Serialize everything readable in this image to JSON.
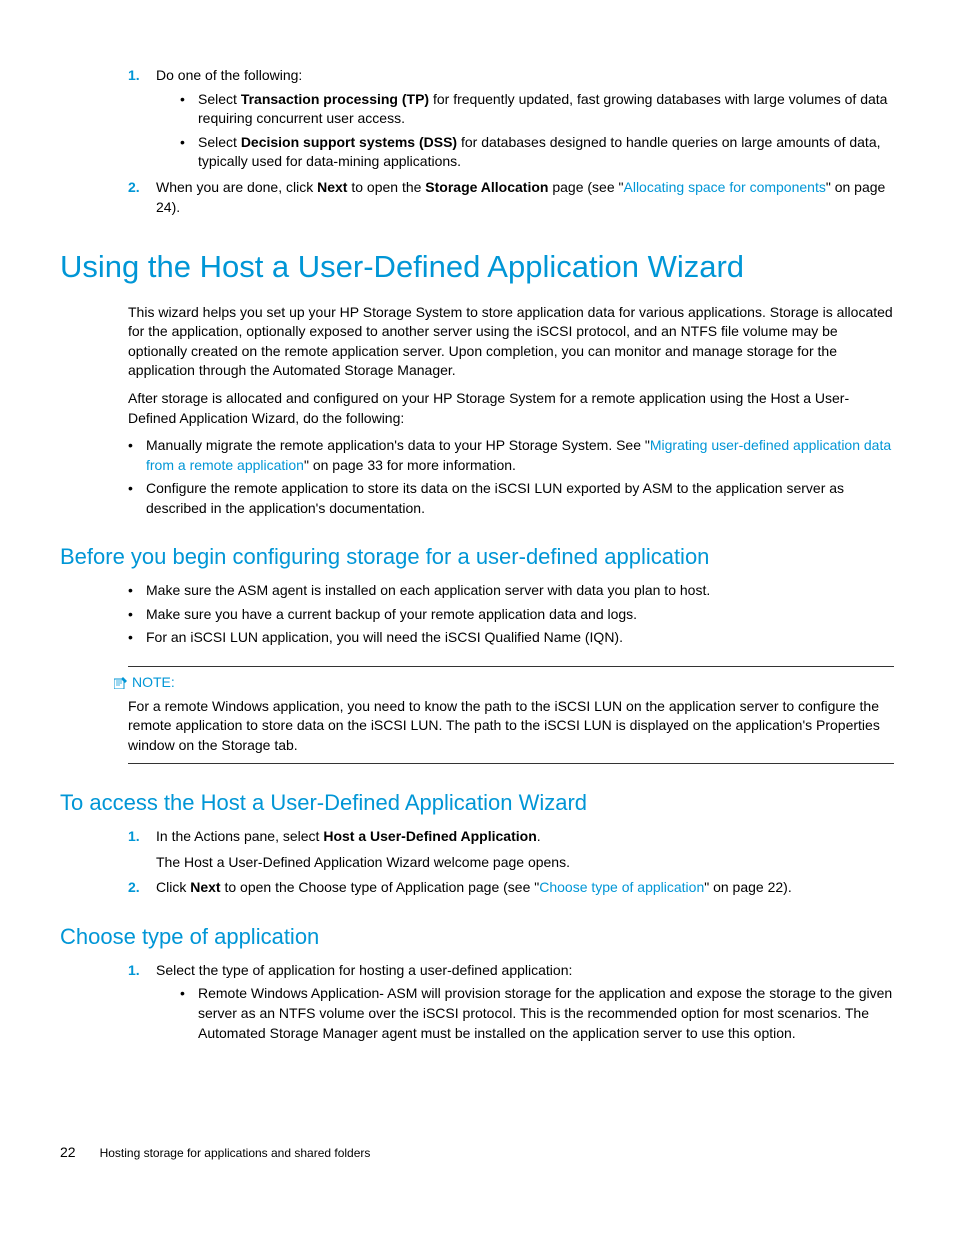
{
  "step1": {
    "marker": "1.",
    "intro": "Do one of the following:",
    "opts": [
      {
        "pre": "Select ",
        "bold": "Transaction processing (TP)",
        "post": " for frequently updated, fast growing databases with large volumes of data requiring concurrent user access."
      },
      {
        "pre": "Select ",
        "bold": "Decision support systems (DSS)",
        "post": " for databases designed to handle queries on large amounts of data, typically used for data-mining applications."
      }
    ]
  },
  "step2": {
    "marker": "2.",
    "pre": "When you are done, click ",
    "bold1": "Next",
    "mid": " to open the ",
    "bold2": "Storage Allocation",
    "post": " page (see \"",
    "link": "Allocating space for components",
    "after": "\" on page 24)."
  },
  "h1": "Using the Host a User-Defined Application Wizard",
  "para1": "This wizard helps you set up your HP Storage System to store application data for various applications. Storage is allocated for the application, optionally exposed to another server using the iSCSI protocol, and an NTFS file volume may be optionally created on the remote application server. Upon completion, you can monitor and manage storage for the application through the Automated Storage Manager.",
  "para2": "After storage is allocated and configured on your HP Storage System for a remote application using the Host a User-Defined Application Wizard, do the following:",
  "after_bullets": [
    {
      "pre": "Manually migrate the remote application's data to your HP Storage System. See \"",
      "link": "Migrating user-defined application data from a remote application",
      "post": "\" on page 33 for more information."
    },
    {
      "text": "Configure the remote application to store its data on the iSCSI LUN exported by ASM to the application server as described in the application's documentation."
    }
  ],
  "h2a": "Before you begin configuring storage for a user-defined application",
  "before_list": [
    "Make sure the ASM agent is installed on each application server with data you plan to host.",
    "Make sure you have a current backup of your remote application data and logs.",
    "For an iSCSI LUN application, you will need the iSCSI Qualified Name (IQN)."
  ],
  "note_label": "NOTE:",
  "note_body": "For a remote Windows application, you need to know the path to the iSCSI LUN on the application server to configure the remote application to store data on the iSCSI LUN. The path to the iSCSI LUN is displayed on the application's Properties window on the Storage tab.",
  "h2b": "To access the Host a User-Defined Application Wizard",
  "access1": {
    "marker": "1.",
    "pre": "In the Actions pane, select ",
    "bold": "Host a User-Defined Application",
    "post": ".",
    "sub": "The Host a User-Defined Application Wizard welcome page opens."
  },
  "access2": {
    "marker": "2.",
    "pre": "Click ",
    "bold": "Next",
    "mid": " to open the Choose type of Application page (see \"",
    "link": "Choose type of application",
    "after": "\" on page 22)."
  },
  "h2c": "Choose type of application",
  "choose1": {
    "marker": "1.",
    "text": "Select the type of application for hosting a user-defined application:",
    "opt": "Remote Windows Application- ASM will provision storage for the application and expose the storage to the given server as an NTFS volume over the iSCSI protocol. This is the recommended option for most scenarios. The Automated Storage Manager agent must be installed on the application server to use this option."
  },
  "footer": {
    "page": "22",
    "chapter": "Hosting storage for applications and shared folders"
  }
}
